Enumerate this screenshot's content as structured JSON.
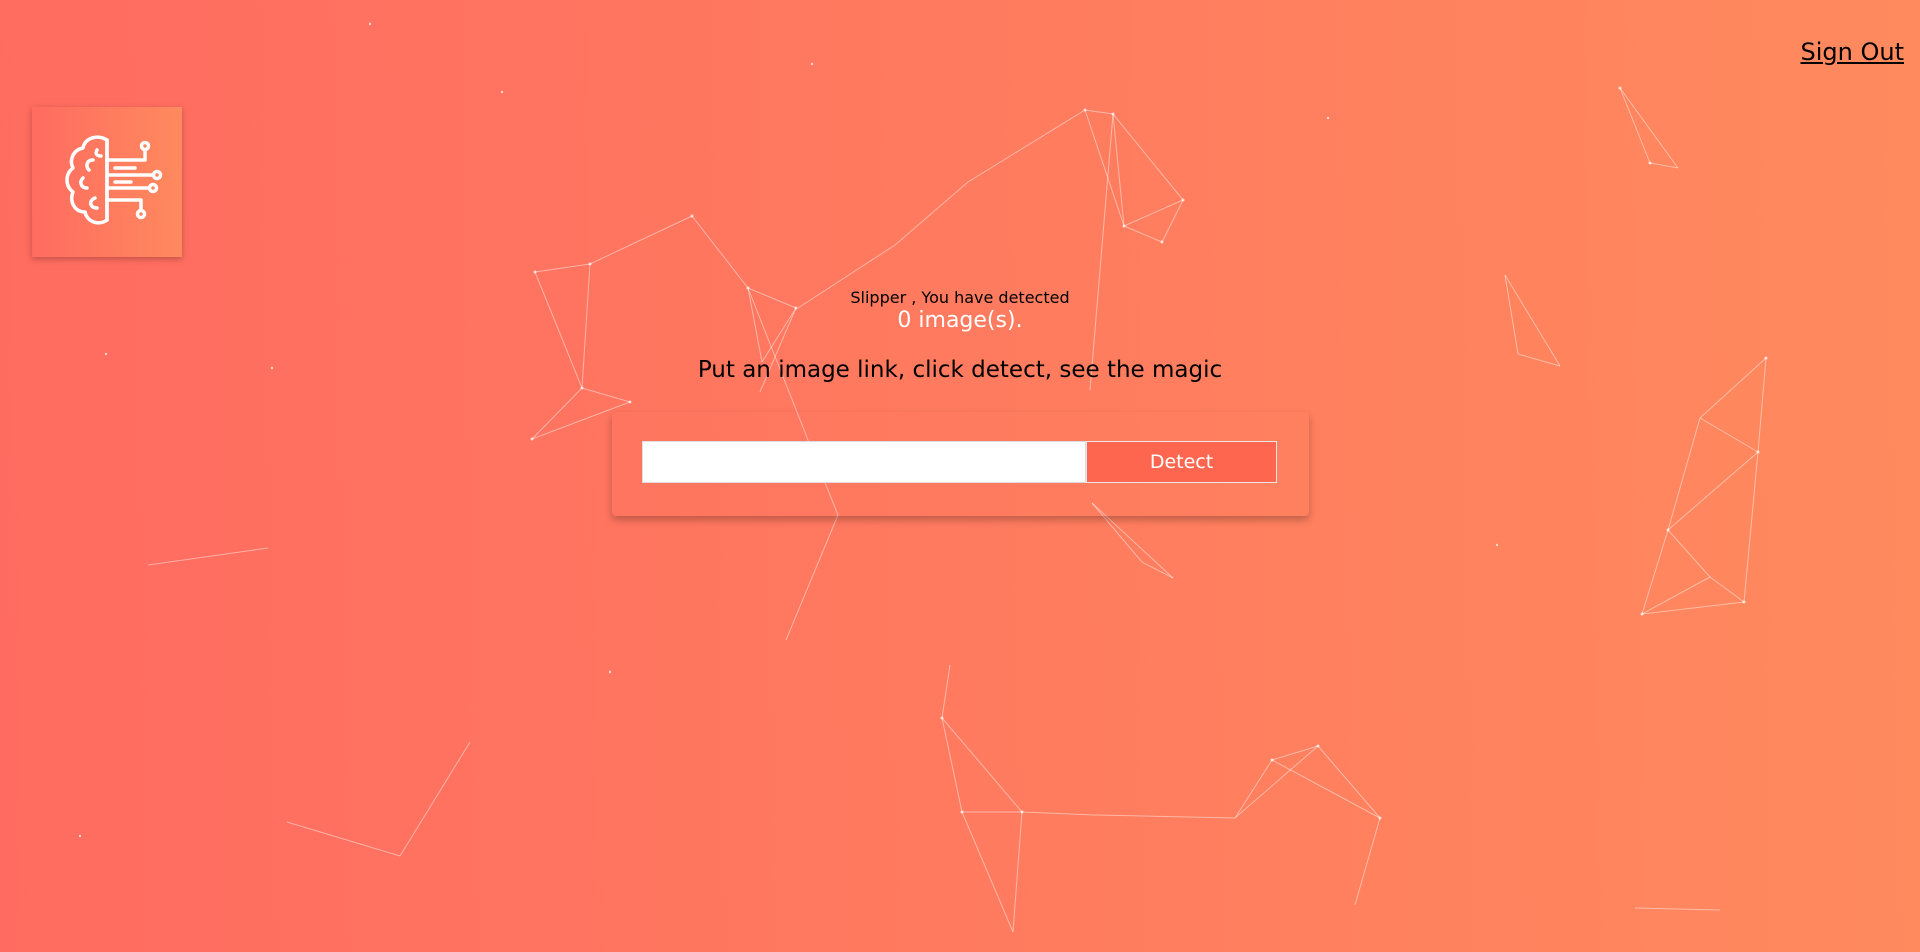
{
  "header": {
    "signout_label": "Sign Out"
  },
  "logo": {
    "icon": "brain-circuit-icon"
  },
  "rank": {
    "greeting": "Slipper , You have detected",
    "count_text": "0 image(s)."
  },
  "instructions": "Put an image link, click detect, see the magic",
  "form": {
    "input_value": "",
    "input_placeholder": "",
    "detect_label": "Detect"
  },
  "colors": {
    "gradient_start": "#ff6b60",
    "gradient_end": "#ff8a5e",
    "button": "#ff6650"
  }
}
